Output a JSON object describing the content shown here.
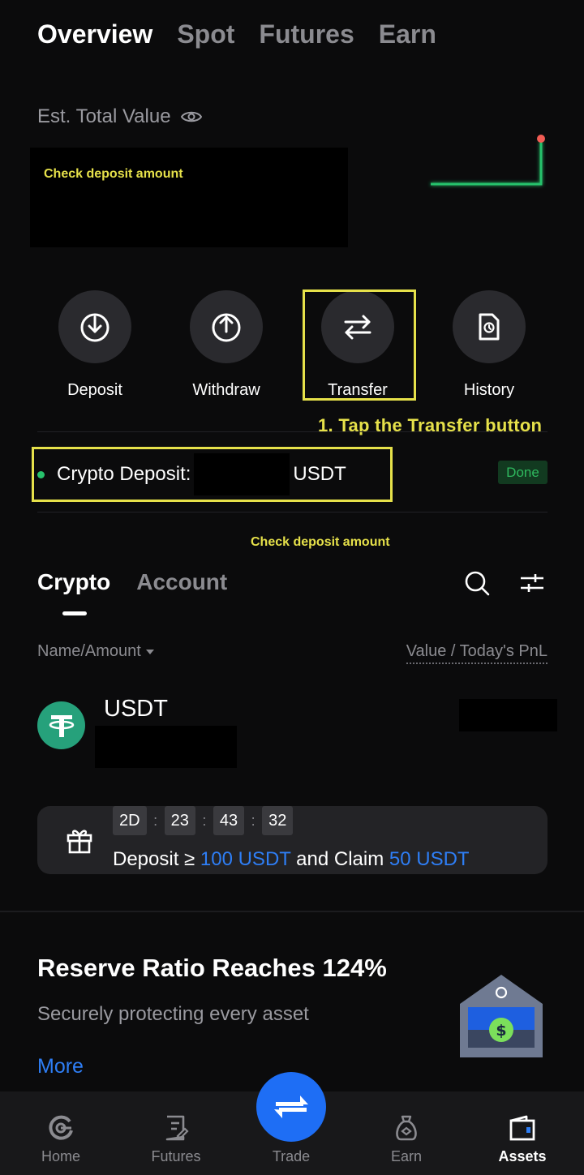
{
  "top_tabs": [
    {
      "label": "Overview",
      "active": true
    },
    {
      "label": "Spot",
      "active": false
    },
    {
      "label": "Futures",
      "active": false
    },
    {
      "label": "Earn",
      "active": false
    }
  ],
  "balance": {
    "label": "Est. Total Value",
    "annotation": "Check deposit amount"
  },
  "actions": [
    {
      "label": "Deposit",
      "icon": "download-icon"
    },
    {
      "label": "Withdraw",
      "icon": "upload-icon"
    },
    {
      "label": "Transfer",
      "icon": "swap-arrows-icon"
    },
    {
      "label": "History",
      "icon": "history-document-icon"
    }
  ],
  "annotations": {
    "transfer_step": "1. Tap the Transfer button",
    "deposit_check": "Check deposit amount"
  },
  "deposit": {
    "label": "Crypto Deposit:",
    "unit": "USDT",
    "status": "Done"
  },
  "asset_tabs": [
    {
      "label": "Crypto",
      "active": true
    },
    {
      "label": "Account",
      "active": false
    }
  ],
  "list_header": {
    "left": "Name/Amount",
    "right": "Value / Today's PnL"
  },
  "coin": {
    "name": "USDT"
  },
  "promo": {
    "timer": [
      "2D",
      "23",
      "43",
      "32"
    ],
    "text_prefix": "Deposit ≥ ",
    "deposit_amount": "100 USDT",
    "text_middle": " and Claim ",
    "claim_amount": "50 USDT"
  },
  "reserve": {
    "title": "Reserve Ratio Reaches 124%",
    "subtitle": "Securely protecting every asset",
    "more": "More"
  },
  "bottom_nav": [
    {
      "label": "Home",
      "icon": "home-icon",
      "active": false
    },
    {
      "label": "Futures",
      "icon": "futures-icon",
      "active": false
    },
    {
      "label": "Trade",
      "icon": "trade-swap-icon",
      "active": false
    },
    {
      "label": "Earn",
      "icon": "earn-icon",
      "active": false
    },
    {
      "label": "Assets",
      "icon": "wallet-icon",
      "active": true
    }
  ],
  "colors": {
    "background": "#0b0b0c",
    "accent_blue": "#2e7ef5",
    "annotation_yellow": "#e6e14a",
    "success_green": "#27c26c",
    "tether_green": "#26a17b"
  }
}
